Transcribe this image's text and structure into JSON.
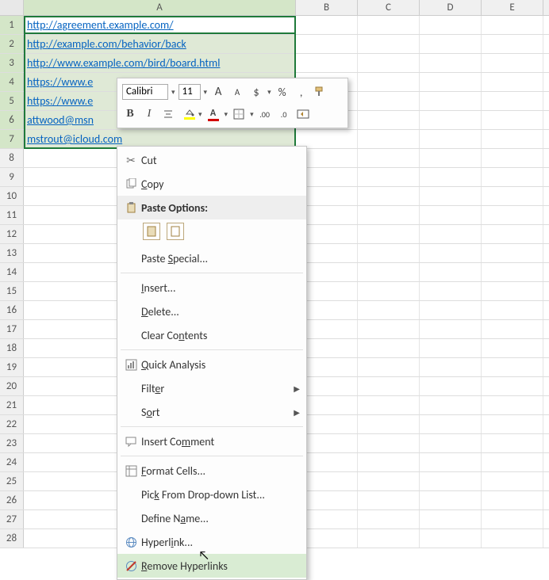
{
  "columns": [
    "A",
    "B",
    "C",
    "D",
    "E"
  ],
  "selected_column": "A",
  "rows_total": 28,
  "selected_rows": [
    1,
    2,
    3,
    4,
    5,
    6,
    7
  ],
  "active_cell_row": 1,
  "cells": {
    "A1": "http://agreement.example.com/",
    "A2": "http://example.com/behavior/back",
    "A3": "http://www.example.com/bird/board.html",
    "A4": "https://www.e",
    "A5": "https://www.e",
    "A6": "attwood@msn",
    "A7": "mstrout@icloud.com"
  },
  "mini_toolbar": {
    "font": "Calibri",
    "size": "11",
    "grow_font": "A",
    "shrink_font": "A",
    "currency": "$",
    "percent": "%",
    "comma": ",",
    "bold": "B",
    "italic": "I",
    "font_color_letter": "A"
  },
  "context_menu": {
    "cut": "Cut",
    "copy": "Copy",
    "paste_options": "Paste Options:",
    "paste_special": "Paste Special...",
    "insert": "Insert...",
    "delete": "Delete...",
    "clear_contents": "Clear Contents",
    "quick_analysis": "Quick Analysis",
    "filter": "Filter",
    "sort": "Sort",
    "insert_comment": "Insert Comment",
    "format_cells": "Format Cells...",
    "pick_from_list": "Pick From Drop-down List...",
    "define_name": "Define Name...",
    "hyperlink": "Hyperlink...",
    "remove_hyperlinks": "Remove Hyperlinks"
  }
}
